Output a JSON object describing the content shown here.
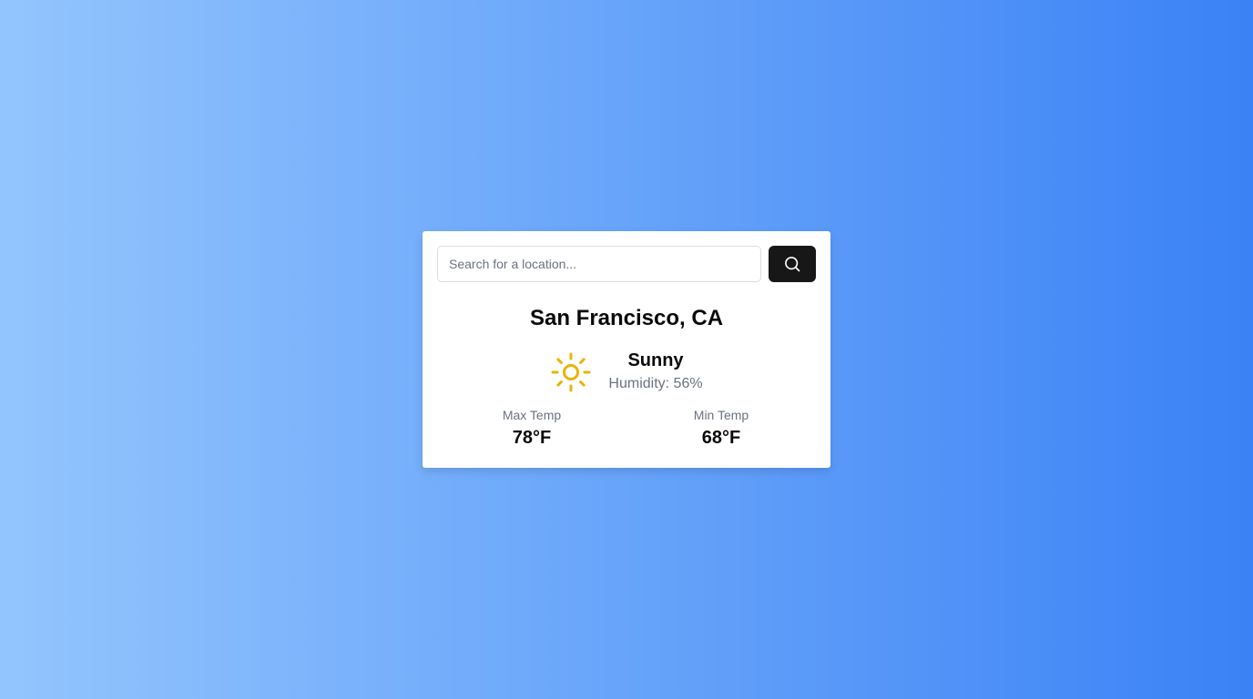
{
  "search": {
    "placeholder": "Search for a location...",
    "value": "",
    "button_icon": "search-icon"
  },
  "weather": {
    "location": "San Francisco, CA",
    "condition": "Sunny",
    "condition_icon": "sun-icon",
    "humidity_text": "Humidity: 56%",
    "max_label": "Max Temp",
    "max_value": "78°F",
    "min_label": "Min Temp",
    "min_value": "68°F"
  },
  "colors": {
    "background_start": "#93c5fd",
    "background_end": "#3b82f6",
    "button": "#171717",
    "sun": "#eab308",
    "muted_text": "#6b7280"
  }
}
